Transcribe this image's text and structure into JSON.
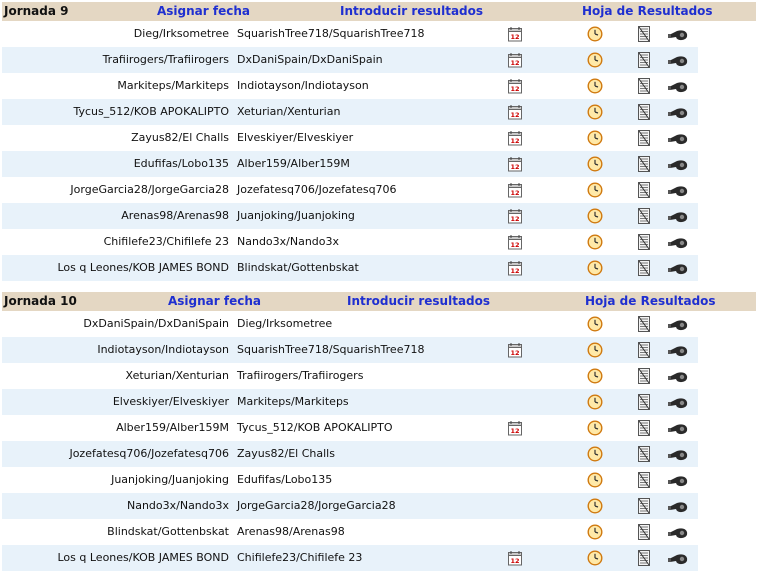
{
  "sections": [
    {
      "title": "Jornada 9",
      "asignar": "Asignar fecha",
      "introducir": "Introducir resultados",
      "hoja": "Hoja de Resultados",
      "rows": [
        {
          "home": "Dieg/Irksometree",
          "away": "SquarishTree718/SquarishTree718"
        },
        {
          "home": "Trafiirogers/Trafiirogers",
          "away": "DxDaniSpain/DxDaniSpain"
        },
        {
          "home": "Markiteps/Markiteps",
          "away": "Indiotayson/Indiotayson"
        },
        {
          "home": "Tycus_512/KOB APOKALIPTO",
          "away": "Xeturian/Xenturian"
        },
        {
          "home": "Zayus82/El Challs",
          "away": "Elveskiyer/Elveskiyer"
        },
        {
          "home": "Edufifas/Lobo135",
          "away": "Alber159/Alber159M"
        },
        {
          "home": "JorgeGarcia28/JorgeGarcia28",
          "away": "Jozefatesq706/Jozefatesq706"
        },
        {
          "home": "Arenas98/Arenas98",
          "away": "Juanjoking/Juanjoking"
        },
        {
          "home": "Chifilefe23/Chifilefe 23",
          "away": "Nando3x/Nando3x"
        },
        {
          "home": "Los q Leones/KOB JAMES BOND",
          "away": "Blindskat/Gottenbskat"
        }
      ]
    },
    {
      "title": "Jornada 10",
      "asignar": "Asignar fecha",
      "introducir": "Introducir resultados",
      "hoja": "Hoja de Resultados",
      "rows": [
        {
          "home": "DxDaniSpain/DxDaniSpain",
          "away": "Dieg/Irksometree"
        },
        {
          "home": "Indiotayson/Indiotayson",
          "away": "SquarishTree718/SquarishTree718"
        },
        {
          "home": "Xeturian/Xenturian",
          "away": "Trafiirogers/Trafiirogers"
        },
        {
          "home": "Elveskiyer/Elveskiyer",
          "away": "Markiteps/Markiteps"
        },
        {
          "home": "Alber159/Alber159M",
          "away": "Tycus_512/KOB APOKALIPTO"
        },
        {
          "home": "Jozefatesq706/Jozefatesq706",
          "away": "Zayus82/El Challs"
        },
        {
          "home": "Juanjoking/Juanjoking",
          "away": "Edufifas/Lobo135"
        },
        {
          "home": "Nando3x/Nando3x",
          "away": "JorgeGarcia28/JorgeGarcia28"
        },
        {
          "home": "Blindskat/Gottenbskat",
          "away": "Arenas98/Arenas98"
        },
        {
          "home": "Los q Leones/KOB JAMES BOND",
          "away": "Chifilefe23/Chifilefe 23"
        }
      ]
    }
  ],
  "icons": {
    "calendar": "calendar-icon",
    "clock": "clock-icon",
    "sheet": "results-sheet-icon",
    "whistle": "whistle-icon"
  }
}
